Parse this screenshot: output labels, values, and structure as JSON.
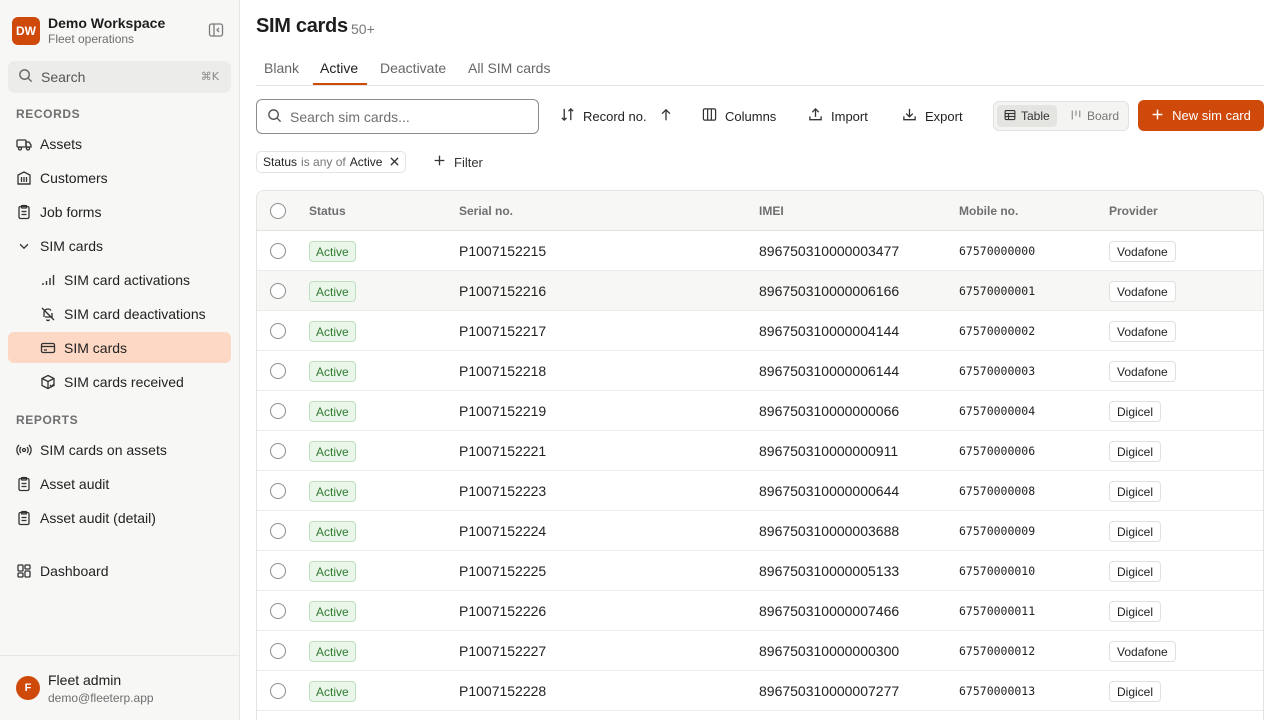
{
  "workspace": {
    "initials": "DW",
    "name": "Demo Workspace",
    "subtitle": "Fleet operations"
  },
  "search": {
    "label": "Search",
    "shortcut": "⌘K"
  },
  "sidebar": {
    "records_title": "RECORDS",
    "reports_title": "REPORTS",
    "items": {
      "assets": "Assets",
      "customers": "Customers",
      "job_forms": "Job forms",
      "sim_cards": "SIM cards",
      "sim_card_activations": "SIM card activations",
      "sim_card_deactivations": "SIM card deactivations",
      "sim_cards_sub": "SIM cards",
      "sim_cards_received": "SIM cards received",
      "sim_cards_on_assets": "SIM cards on assets",
      "asset_audit": "Asset audit",
      "asset_audit_detail": "Asset audit (detail)",
      "dashboard": "Dashboard"
    }
  },
  "user": {
    "initial": "F",
    "name": "Fleet admin",
    "email": "demo@fleeterp.app"
  },
  "page": {
    "title": "SIM cards",
    "count": "50+"
  },
  "tabs": {
    "blank": "Blank",
    "active": "Active",
    "deactivate": "Deactivate",
    "all": "All SIM cards"
  },
  "toolbar": {
    "search_placeholder": "Search sim cards...",
    "sort_label": "Record no.",
    "columns_label": "Columns",
    "import_label": "Import",
    "export_label": "Export",
    "table_label": "Table",
    "board_label": "Board",
    "new_label": "New sim card"
  },
  "filter": {
    "field": "Status",
    "operator": "is any of",
    "value": "Active",
    "add_label": "Filter"
  },
  "table": {
    "headers": {
      "status": "Status",
      "serial": "Serial no.",
      "imei": "IMEI",
      "mobile": "Mobile no.",
      "provider": "Provider"
    },
    "rows": [
      {
        "status": "Active",
        "serial": "P1007152215",
        "imei": "896750310000003477",
        "mobile": "67570000000",
        "provider": "Vodafone"
      },
      {
        "status": "Active",
        "serial": "P1007152216",
        "imei": "896750310000006166",
        "mobile": "67570000001",
        "provider": "Vodafone"
      },
      {
        "status": "Active",
        "serial": "P1007152217",
        "imei": "896750310000004144",
        "mobile": "67570000002",
        "provider": "Vodafone"
      },
      {
        "status": "Active",
        "serial": "P1007152218",
        "imei": "896750310000006144",
        "mobile": "67570000003",
        "provider": "Vodafone"
      },
      {
        "status": "Active",
        "serial": "P1007152219",
        "imei": "896750310000000066",
        "mobile": "67570000004",
        "provider": "Digicel"
      },
      {
        "status": "Active",
        "serial": "P1007152221",
        "imei": "896750310000000911",
        "mobile": "67570000006",
        "provider": "Digicel"
      },
      {
        "status": "Active",
        "serial": "P1007152223",
        "imei": "896750310000000644",
        "mobile": "67570000008",
        "provider": "Digicel"
      },
      {
        "status": "Active",
        "serial": "P1007152224",
        "imei": "896750310000003688",
        "mobile": "67570000009",
        "provider": "Digicel"
      },
      {
        "status": "Active",
        "serial": "P1007152225",
        "imei": "896750310000005133",
        "mobile": "67570000010",
        "provider": "Digicel"
      },
      {
        "status": "Active",
        "serial": "P1007152226",
        "imei": "896750310000007466",
        "mobile": "67570000011",
        "provider": "Digicel"
      },
      {
        "status": "Active",
        "serial": "P1007152227",
        "imei": "896750310000000300",
        "mobile": "67570000012",
        "provider": "Vodafone"
      },
      {
        "status": "Active",
        "serial": "P1007152228",
        "imei": "896750310000007277",
        "mobile": "67570000013",
        "provider": "Digicel"
      }
    ]
  },
  "colors": {
    "accent": "#cf4a0a",
    "active_nav_bg": "#fdd8c5",
    "status_green": "#2f7a2f"
  }
}
